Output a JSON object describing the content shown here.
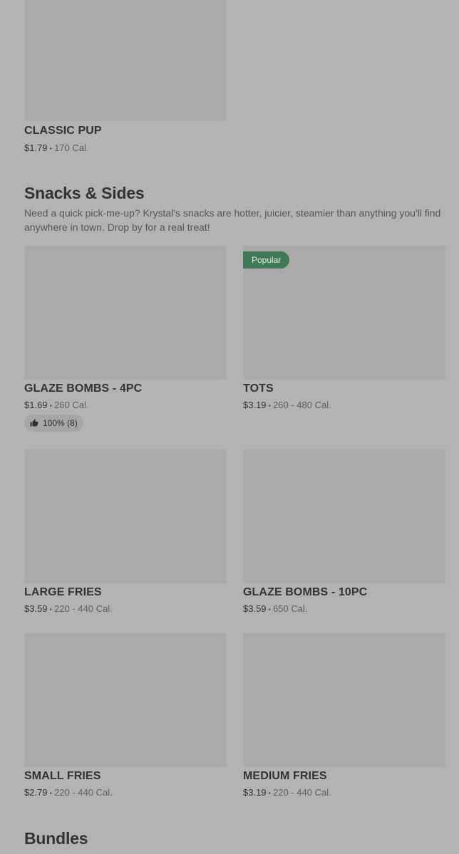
{
  "top_item": {
    "name": "CLASSIC PUP",
    "price": "$1.79",
    "calories": "170 Cal."
  },
  "snacks": {
    "title": "Snacks & Sides",
    "description": "Need a quick pick-me-up? Krystal's snacks are hotter, juicier, steamier than anything you'll find anywhere in town. Drop by for a real treat!",
    "items": [
      {
        "name": "GLAZE BOMBS - 4PC",
        "price": "$1.69",
        "calories": "260 Cal.",
        "rating": "100% (8)"
      },
      {
        "name": "TOTS",
        "price": "$3.19",
        "calories": "260 - 480 Cal.",
        "badge": "Popular"
      },
      {
        "name": "LARGE FRIES",
        "price": "$3.59",
        "calories": "220 - 440 Cal."
      },
      {
        "name": "GLAZE BOMBS - 10PC",
        "price": "$3.59",
        "calories": "650 Cal."
      },
      {
        "name": "SMALL FRIES",
        "price": "$2.79",
        "calories": "220 - 440 Cal."
      },
      {
        "name": "MEDIUM FRIES",
        "price": "$3.19",
        "calories": "220 - 440 Cal."
      }
    ]
  },
  "bundles": {
    "title": "Bundles"
  },
  "separator": "•",
  "icons": {
    "rating": "thumbs-up-icon"
  },
  "colors": {
    "badge": "#3d7a55",
    "background": "#b3b3b3"
  }
}
